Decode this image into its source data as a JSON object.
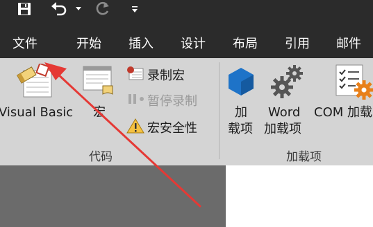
{
  "quick_access": {
    "icons": [
      "save-icon",
      "undo-icon",
      "undo-dropdown-icon",
      "redo-icon",
      "customize-qat-icon"
    ]
  },
  "tabs": [
    "文件",
    "开始",
    "插入",
    "设计",
    "布局",
    "引用",
    "邮件"
  ],
  "ribbon": {
    "code_group": {
      "label": "代码",
      "visual_basic": "Visual Basic",
      "macros": "宏",
      "record_macro": "录制宏",
      "pause_recording": "暂停录制",
      "macro_security": "宏安全性"
    },
    "addins_group": {
      "label": "加载项",
      "addins_line1": "加",
      "addins_line2": "载项",
      "word_addins_line1": "Word",
      "word_addins_line2": "加载项",
      "com_addins": "COM 加载"
    }
  },
  "colors": {
    "title_bar": "#2b2b2b",
    "ribbon_bg": "#d4d4d4",
    "annotation_arrow": "#e53935",
    "addin_blue": "#1e73c8",
    "gear_orange": "#e8801a",
    "record_red": "#c0392b"
  }
}
